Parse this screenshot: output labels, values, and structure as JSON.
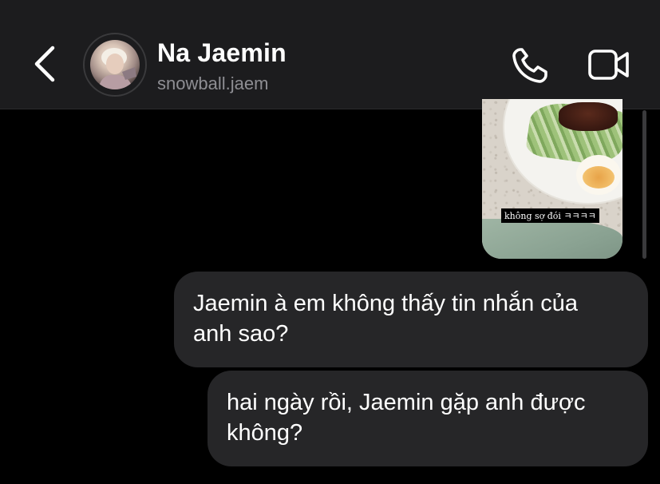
{
  "header": {
    "name": "Na Jaemin",
    "username": "snowball.jaem",
    "back_icon": "chevron-left-icon",
    "call_icon": "phone-icon",
    "video_icon": "video-camera-icon"
  },
  "shared_photo": {
    "caption": "không sợ đói ㅋㅋㅋㅋ"
  },
  "messages": [
    {
      "text_line1": "Jaemin à em không thấy tin nhắn của",
      "text_line2": "anh sao?"
    },
    {
      "text_line1": "hai ngày rồi, Jaemin gặp anh được",
      "text_line2": "không?"
    }
  ],
  "colors": {
    "background": "#000000",
    "header": "#1c1c1e",
    "bubble": "#262628",
    "secondary_text": "#8e8e93"
  }
}
